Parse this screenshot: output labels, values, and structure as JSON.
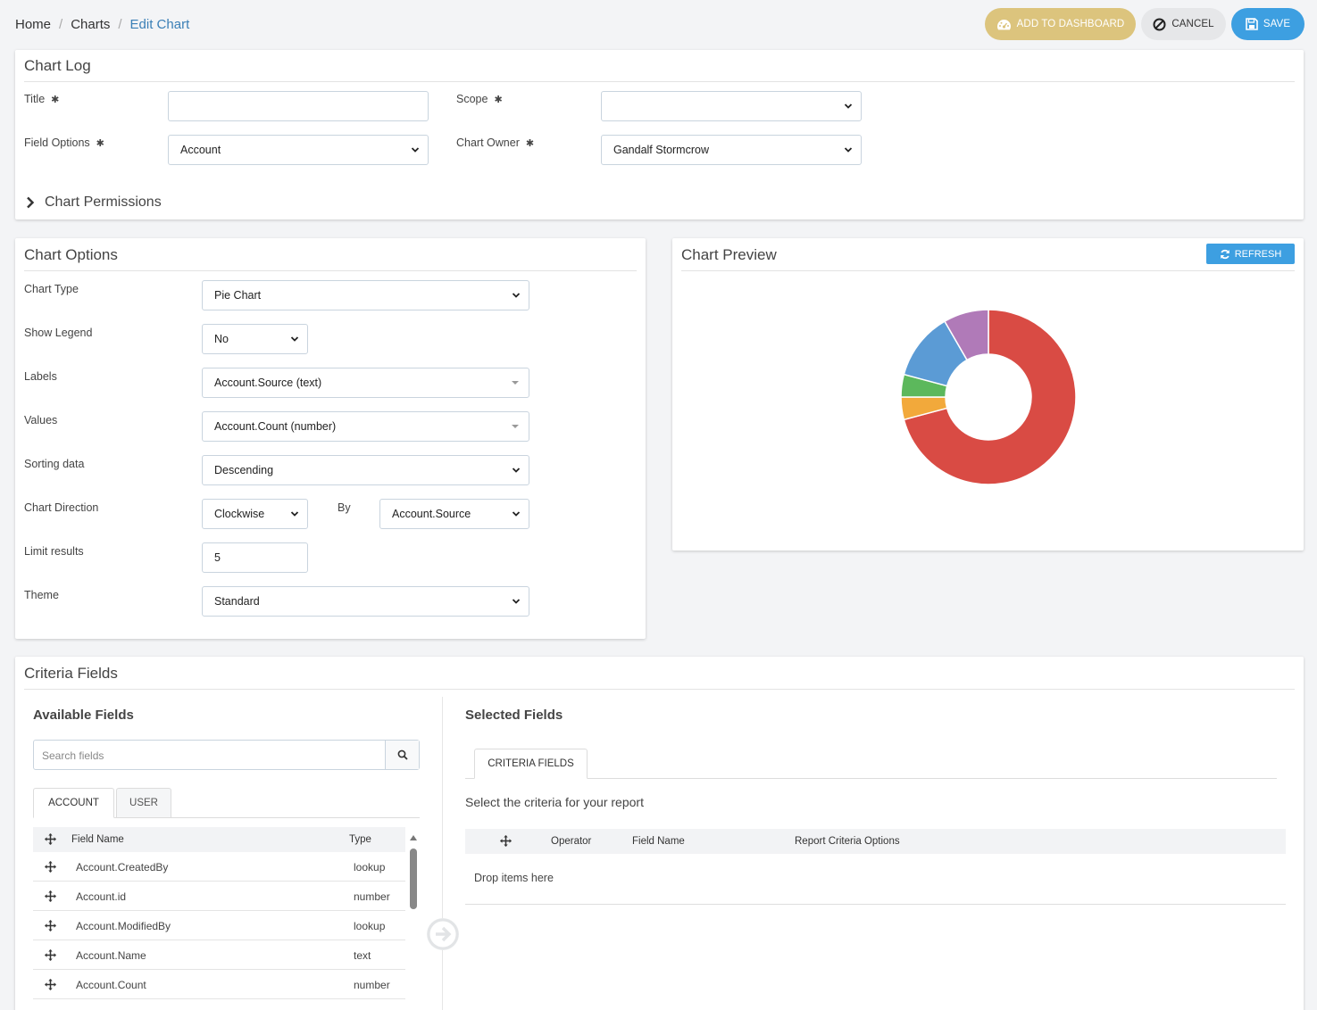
{
  "breadcrumb": {
    "home": "Home",
    "charts": "Charts",
    "current": "Edit Chart"
  },
  "toolbar": {
    "add_to_dashboard": "ADD TO DASHBOARD",
    "cancel": "CANCEL",
    "save": "SAVE"
  },
  "chart_log": {
    "title": "Chart Log",
    "title_label": "Title",
    "title_value": "",
    "scope_label": "Scope",
    "scope_value": "",
    "field_options_label": "Field Options",
    "field_options_value": "Account",
    "chart_owner_label": "Chart Owner",
    "chart_owner_value": "Gandalf Stormcrow",
    "required_mark": "✱",
    "permissions_label": "Chart Permissions"
  },
  "chart_options": {
    "title": "Chart Options",
    "chart_type_label": "Chart Type",
    "chart_type_value": "Pie Chart",
    "show_legend_label": "Show Legend",
    "show_legend_value": "No",
    "labels_label": "Labels",
    "labels_value": "Account.Source (text)",
    "values_label": "Values",
    "values_value": "Account.Count (number)",
    "sorting_label": "Sorting data",
    "sorting_value": "Descending",
    "direction_label": "Chart Direction",
    "direction_value": "Clockwise",
    "by_label": "By",
    "by_value": "Account.Source",
    "limit_label": "Limit results",
    "limit_value": "5",
    "theme_label": "Theme",
    "theme_value": "Standard"
  },
  "chart_preview": {
    "title": "Chart Preview",
    "refresh": "REFRESH"
  },
  "chart_data": {
    "type": "pie",
    "donut": true,
    "direction": "clockwise",
    "legend": false,
    "slices": [
      {
        "value": 68,
        "color": "#d94b44"
      },
      {
        "value": 4,
        "color": "#f2a93b"
      },
      {
        "value": 4,
        "color": "#5cb85c"
      },
      {
        "value": 12,
        "color": "#5b9bd5"
      },
      {
        "value": 8,
        "color": "#b07ab8"
      }
    ]
  },
  "criteria": {
    "title": "Criteria Fields",
    "available_title": "Available Fields",
    "search_placeholder": "Search fields",
    "tabs": [
      "ACCOUNT",
      "USER"
    ],
    "columns": {
      "field_name": "Field Name",
      "type": "Type"
    },
    "rows": [
      {
        "name": "Account.CreatedBy",
        "type": "lookup"
      },
      {
        "name": "Account.id",
        "type": "number"
      },
      {
        "name": "Account.ModifiedBy",
        "type": "lookup"
      },
      {
        "name": "Account.Name",
        "type": "text"
      },
      {
        "name": "Account.Count",
        "type": "number"
      }
    ],
    "selected_title": "Selected Fields",
    "selected_tab": "CRITERIA FIELDS",
    "instructions": "Select the criteria for your report",
    "selected_columns": {
      "operator": "Operator",
      "field_name": "Field Name",
      "options": "Report Criteria Options"
    },
    "drop_text": "Drop items here"
  }
}
